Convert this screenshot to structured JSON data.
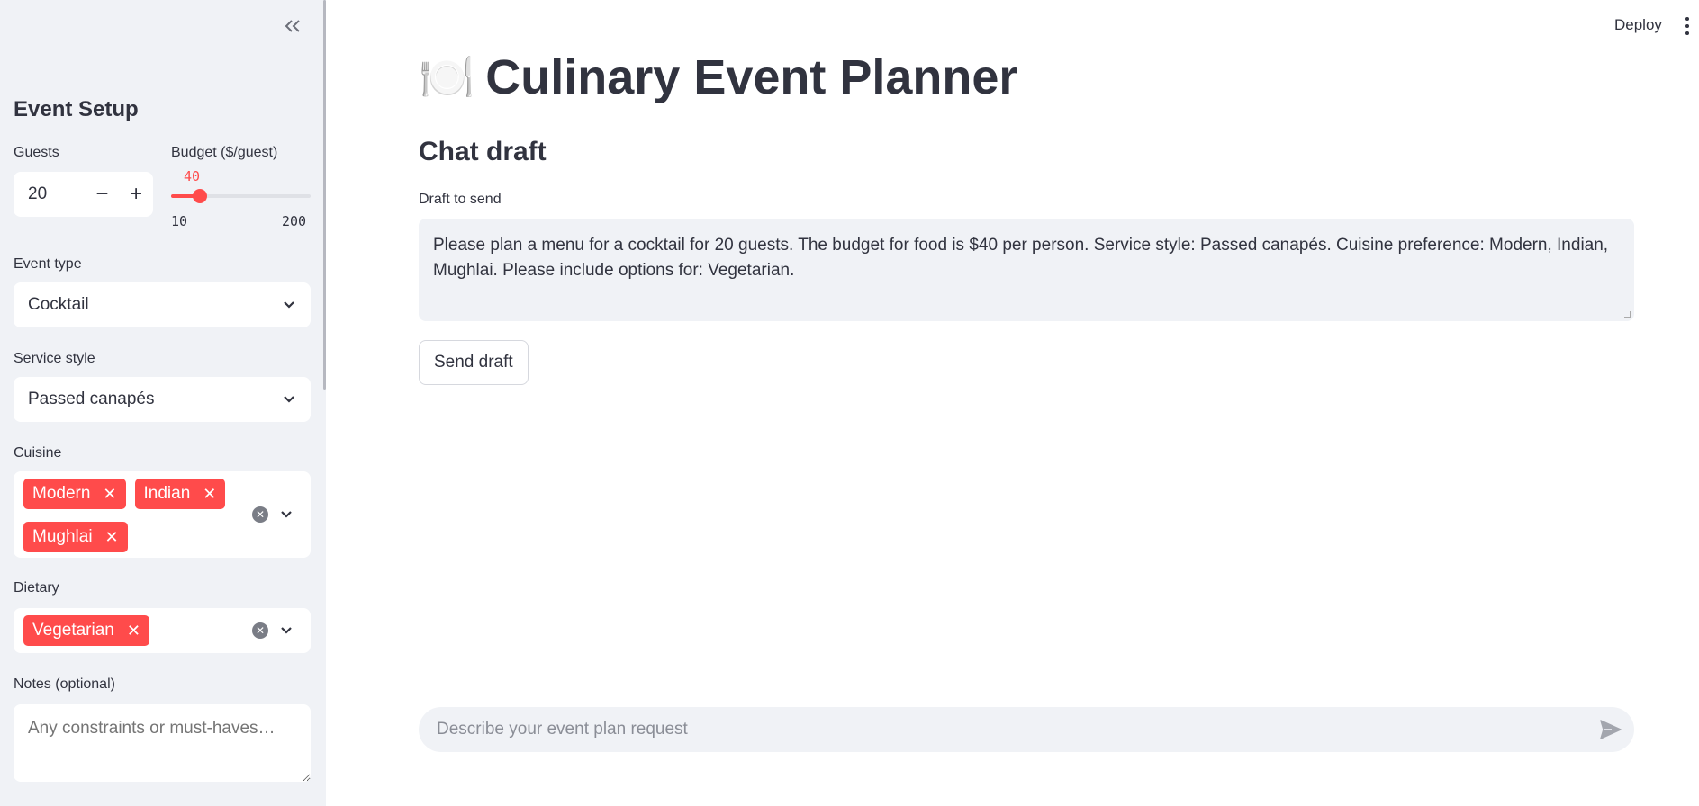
{
  "sidebar": {
    "collapse_icon": "double-chevron-left-icon",
    "title": "Event Setup",
    "guests": {
      "label": "Guests",
      "value": "20",
      "minus": "−",
      "plus": "+"
    },
    "budget": {
      "label": "Budget ($/guest)",
      "value": "40",
      "min": "10",
      "max": "200",
      "current": 40,
      "min_num": 10,
      "max_num": 200
    },
    "event_type": {
      "label": "Event type",
      "value": "Cocktail"
    },
    "service_style": {
      "label": "Service style",
      "value": "Passed canapés"
    },
    "cuisine": {
      "label": "Cuisine",
      "tags": [
        "Modern",
        "Indian",
        "Mughlai"
      ]
    },
    "dietary": {
      "label": "Dietary",
      "tags": [
        "Vegetarian"
      ]
    },
    "notes": {
      "label": "Notes (optional)",
      "placeholder": "Any constraints or must-haves…"
    }
  },
  "header": {
    "deploy_label": "Deploy",
    "menu_icon": "more-vertical-icon"
  },
  "main": {
    "title_emoji": "🍽️",
    "title": "Culinary Event Planner",
    "section_title": "Chat draft",
    "draft_label": "Draft to send",
    "draft_text": "Please plan a menu for a cocktail for 20 guests. The budget for food is $40 per person. Service style: Passed canapés. Cuisine preference: Modern, Indian, Mughlai. Please include options for: Vegetarian.",
    "send_draft_label": "Send draft",
    "chat_placeholder": "Describe your event plan request",
    "send_icon": "send-icon"
  },
  "colors": {
    "accent": "#ff4b4b",
    "sidebar_bg": "#f0f2f6",
    "text": "#31333f"
  }
}
